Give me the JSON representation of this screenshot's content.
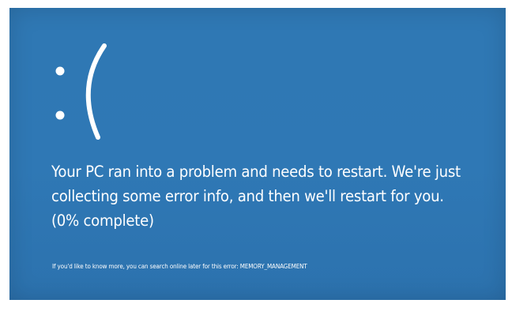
{
  "bsod": {
    "face": ":(",
    "message": "Your PC ran into a problem and needs to restart. We're just collecting some error info, and then we'll restart for you. (0% complete)",
    "progress_percent": 0,
    "hint_prefix": "If you'd like to know more, you can search online later for this error: ",
    "error_code": "MEMORY_MANAGEMENT"
  },
  "colors": {
    "background": "#2f78b4",
    "text": "#ffffff"
  }
}
